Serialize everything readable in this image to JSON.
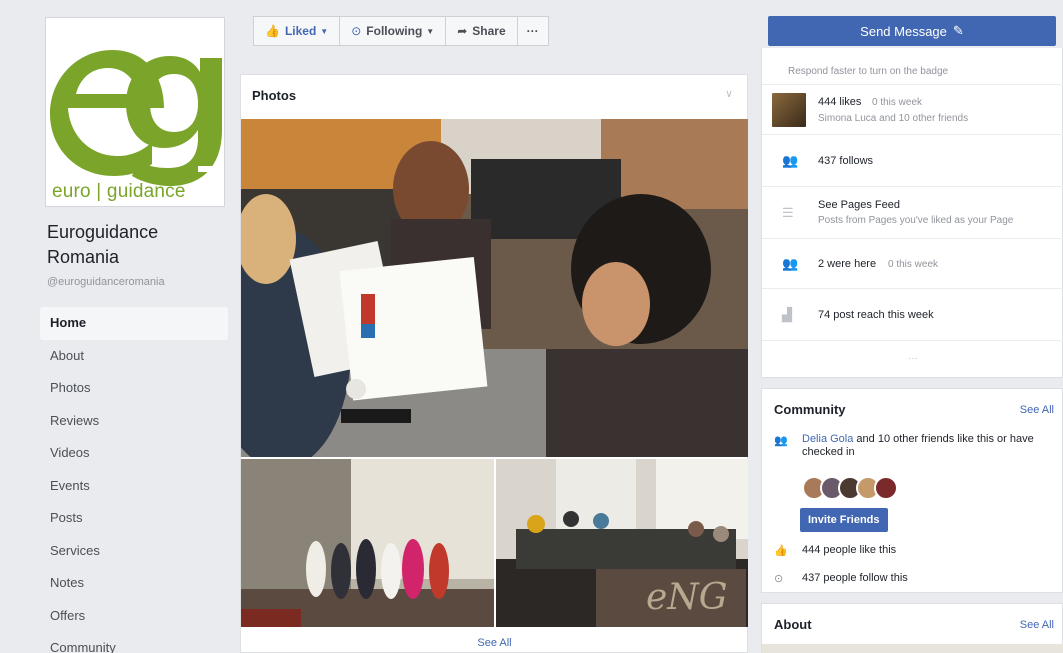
{
  "page": {
    "name": "Euroguidance Romania",
    "handle": "@euroguidanceromania",
    "logo_text": "euro | guidance",
    "logo_letters": "eg",
    "brand_color": "#7aa52a"
  },
  "nav": [
    {
      "label": "Home",
      "active": true
    },
    {
      "label": "About"
    },
    {
      "label": "Photos"
    },
    {
      "label": "Reviews"
    },
    {
      "label": "Videos"
    },
    {
      "label": "Events"
    },
    {
      "label": "Posts"
    },
    {
      "label": "Services"
    },
    {
      "label": "Notes"
    },
    {
      "label": "Offers"
    },
    {
      "label": "Community"
    }
  ],
  "actions": {
    "liked": "Liked",
    "following": "Following",
    "share": "Share",
    "more": "···"
  },
  "photos": {
    "title": "Photos",
    "see_all": "See All"
  },
  "right": {
    "send_message": "Send Message",
    "badge_hint": "Respond faster to turn on the badge",
    "likes": "444 likes",
    "likes_week": "0 this week",
    "likes_friends": "Simona Luca and 10 other friends",
    "follows": "437 follows",
    "feed_title": "See Pages Feed",
    "feed_sub": "Posts from Pages you've liked as your Page",
    "were_here": "2 were here",
    "were_here_week": "0 this week",
    "reach": "74 post reach this week",
    "more_dots": "···"
  },
  "community": {
    "title": "Community",
    "see_all": "See All",
    "friend_name": "Delia Gola",
    "friends_text": "and 10 other friends like this or have checked in",
    "invite": "Invite Friends",
    "likes_text": "444 people like this",
    "follows_text": "437 people follow this"
  },
  "about": {
    "title": "About",
    "see_all": "See All"
  },
  "accent": "#4267b2"
}
